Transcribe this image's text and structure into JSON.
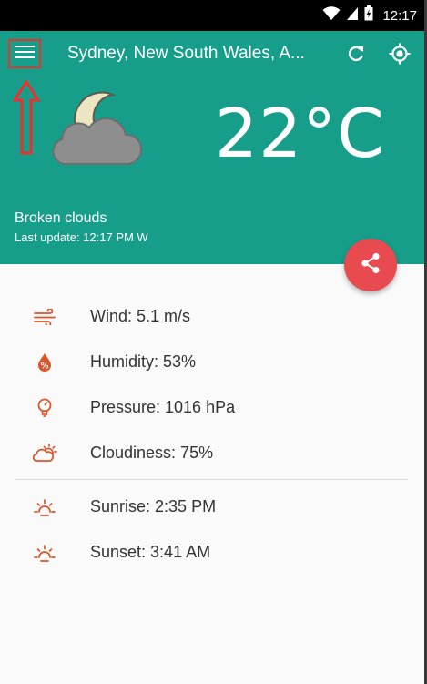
{
  "status_bar": {
    "time": "12:17"
  },
  "header": {
    "location": "Sydney, New South Wales, A...",
    "temperature": "22°C",
    "condition": "Broken clouds",
    "last_update": "Last update: 12:17 PM W"
  },
  "details": {
    "wind": "Wind: 5.1 m/s",
    "humidity": "Humidity: 53%",
    "pressure": "Pressure: 1016 hPa",
    "cloudiness": "Cloudiness: 75%",
    "sunrise": "Sunrise: 2:35 PM",
    "sunset": "Sunset: 3:41 AM"
  },
  "colors": {
    "header_bg": "#179e8b",
    "fab_bg": "#e84b4f",
    "icon_accent": "#d9552b",
    "annotation": "#e8332d"
  },
  "icons": {
    "menu": "menu-icon",
    "refresh": "refresh-icon",
    "locate": "locate-icon",
    "share": "share-icon",
    "weather": "cloud-moon-icon"
  }
}
